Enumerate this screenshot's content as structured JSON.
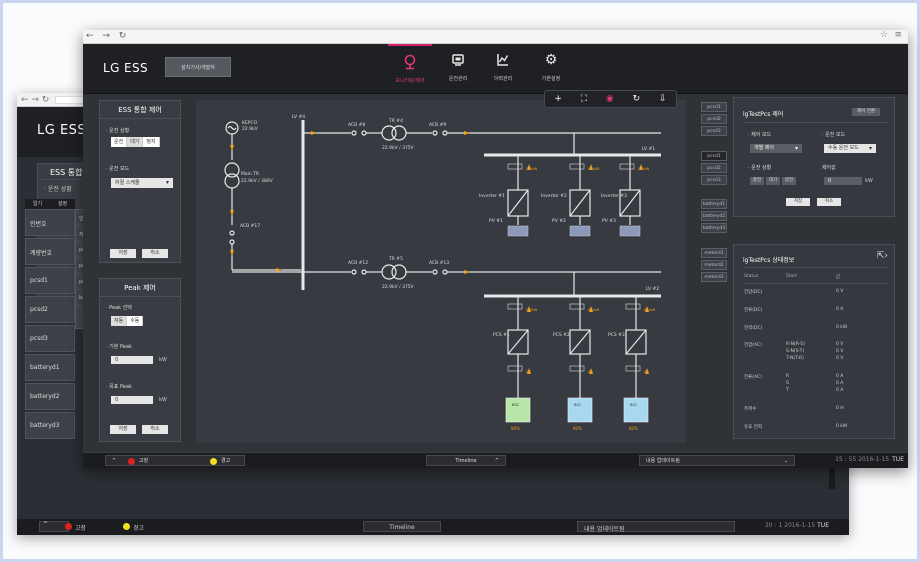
{
  "app": {
    "logo": "LG ESS",
    "operator_button": "설치기사/개발자",
    "nav": [
      {
        "label": "모니터링/제어",
        "icon": "location-pin-icon",
        "active": true
      },
      {
        "label": "운전관리",
        "icon": "device-icon",
        "active": false
      },
      {
        "label": "이력관리",
        "icon": "chart-icon",
        "active": false
      },
      {
        "label": "기본설정",
        "icon": "gear-icon",
        "active": false
      }
    ]
  },
  "ess_control": {
    "title": "ESS 통합 제어",
    "run_state_label": "· 운전 상황",
    "run_state_options": [
      "운전",
      "대기",
      "정지"
    ],
    "run_state_selected": "대기",
    "run_mode_label": "· 운전 모드",
    "run_mode_value": "하절 스케줄",
    "save": "저장",
    "cancel": "취소"
  },
  "peak_control": {
    "title": "Peak 제어",
    "select_label": "· Peak 선택",
    "select_options": [
      "자동",
      "수동"
    ],
    "select_selected": "자동",
    "base_label": "· 기본 Peak",
    "base_value": "0",
    "base_unit": "kW",
    "target_label": "· 목표 Peak",
    "target_value": "0",
    "target_unit": "kW",
    "save": "저장",
    "cancel": "취소"
  },
  "diagram": {
    "grid_source": "KEPCO",
    "grid_voltage": "22.9kV",
    "lv_bus_1": "LV #4",
    "acb_1": "ACB #8",
    "tr_1": "TR #4",
    "acb_2": "ACB #9",
    "tr_1_rating": "22.9kV / 375V",
    "lv_bus_2": "LV #1",
    "main_tr": "Main TR",
    "main_tr_rating": "22.9kV / 380V",
    "acb_main": "ACB #17",
    "inverters": [
      "Inverter #1",
      "Inverter #2",
      "Inverter #3"
    ],
    "pvs": [
      "PV #1",
      "PV #2",
      "PV #3"
    ],
    "pv_values": [
      "0.0kW",
      "0.0kW",
      "0.0kW"
    ],
    "acb_3": "ACB #12",
    "tr_2": "TR #5",
    "acb_4": "ACB #13",
    "tr_2_rating": "22.9kV / 375V",
    "lv_bus_3": "LV #2",
    "pcs": [
      "PCS #1",
      "PCS #2",
      "PCS #3"
    ],
    "bat_labels": [
      "BSC",
      "BSC",
      "BSC"
    ],
    "soc": [
      "80%",
      "90%",
      "80%"
    ],
    "pcs_kw_values": [
      "0.0kW",
      "0.0kW",
      "0.0kW"
    ],
    "dc_values": [
      "0V",
      "0V",
      "0V"
    ]
  },
  "device_list": {
    "pcs": [
      "pcsd1",
      "pcsd2",
      "pcsd3"
    ],
    "pcs_b": [
      "pcsd1",
      "pcsd2",
      "pcsd3"
    ],
    "battery": [
      "batteryd1",
      "batteryd2",
      "batteryd3"
    ],
    "meter": [
      "meterd1",
      "meterd2",
      "meterd3"
    ]
  },
  "pcs_control": {
    "title": "lgTestPcs 제어",
    "top_button": "제어 전환",
    "ctrl_mode_label": "· 제어 모드",
    "ctrl_mode_value": "개별 제어",
    "run_mode_label": "· 운전 모드",
    "run_mode_value": "수동 운전 모드",
    "run_state_label": "· 운전 상황",
    "run_state_options": [
      "충전",
      "대기",
      "방전"
    ],
    "control_value_label": "제어값",
    "control_value": "0",
    "control_unit": "kW",
    "save": "저장",
    "cancel": "취소"
  },
  "pcs_status": {
    "title": "lgTestPcs 상태정보",
    "headers": [
      "Status",
      "Start",
      "값"
    ],
    "rows": [
      {
        "k": "전압(DC)",
        "s": "",
        "v": "0 V"
      },
      {
        "k": "전류(DC)",
        "s": "",
        "v": "0 A"
      },
      {
        "k": "전력(DC)",
        "s": "",
        "v": "0 kW"
      },
      {
        "k": "전압(AC)",
        "s": "R-N(R-S)",
        "v": "0 V"
      },
      {
        "k": "",
        "s": "S-N(S-T)",
        "v": "0 V"
      },
      {
        "k": "",
        "s": "T-N(T-R)",
        "v": "0 V"
      },
      {
        "k": "전류(AC)",
        "s": "R",
        "v": "0 A"
      },
      {
        "k": "",
        "s": "S",
        "v": "0 A"
      },
      {
        "k": "",
        "s": "T",
        "v": "0 A"
      },
      {
        "k": "주파수",
        "s": "",
        "v": "0 H"
      },
      {
        "k": "유효 전력",
        "s": "",
        "v": "0 kW"
      }
    ]
  },
  "status_bar": {
    "alarm_fault": "고장",
    "alarm_warning": "경고",
    "timeline": "Timeline",
    "area_select": "내용 업데이트됨",
    "datetime": "15 : 55  2016-1-15",
    "weekday": "TUE"
  },
  "bg_window": {
    "logo": "LG ESS",
    "panel_title": "ESS 통합",
    "panel_label": "· 운전 상황",
    "tabs": [
      "일기",
      "설정"
    ],
    "list": [
      "인번호",
      "계량번호",
      "pcsd1",
      "pcsd2",
      "pcsd3",
      "batteryd1",
      "batteryd2",
      "batteryd3"
    ],
    "popup": [
      "인번호",
      "지접적",
      "pcsd1",
      "pcsd2",
      "pcsd3",
      "batter"
    ],
    "alarm_fault": "고장",
    "alarm_warning": "경고",
    "timeline": "Timeline",
    "area_select": "내용 업데이트됨",
    "datetime": "20 : 1 2016-1-15",
    "weekday": "TUE"
  },
  "colors": {
    "accent": "#d6206b",
    "bg_dark": "#1e2024",
    "panel": "#393c42",
    "line": "#e8e8e8",
    "flow": "#f0a020",
    "bat_green": "#b8e6a8",
    "bat_blue": "#a8d8f0",
    "fault": "#e02020",
    "warning": "#f0e020"
  }
}
